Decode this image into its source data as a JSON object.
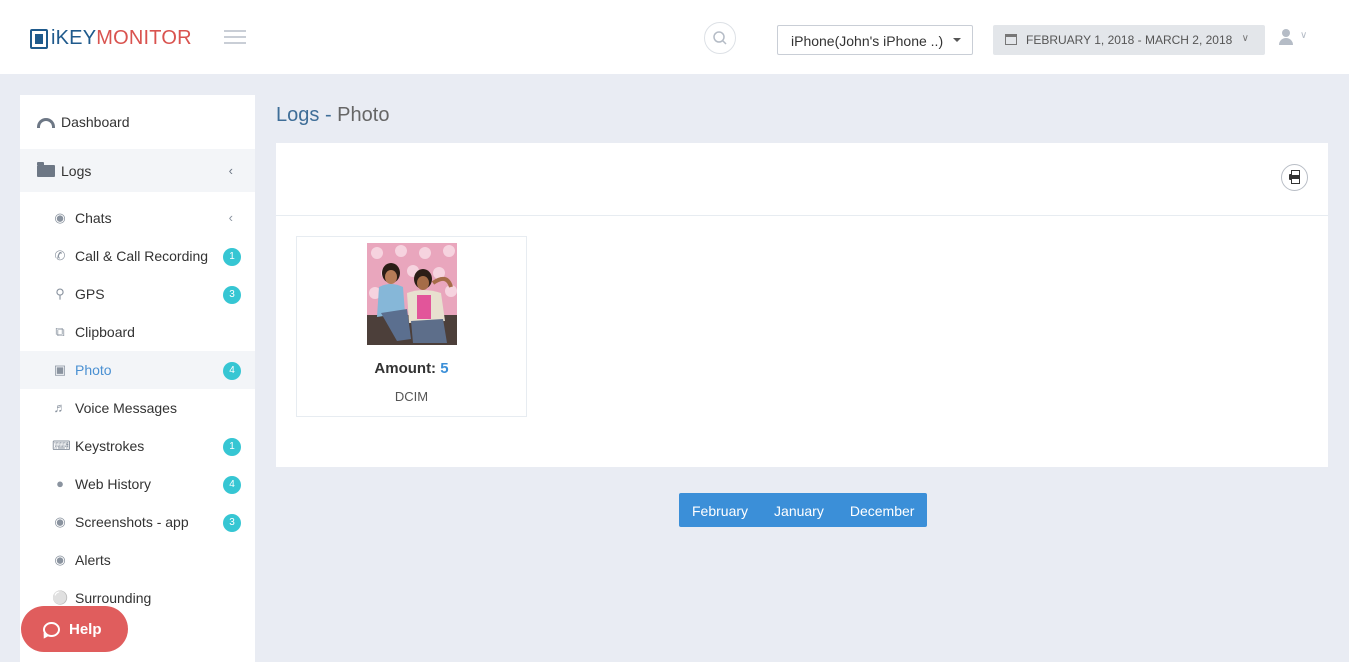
{
  "brand": {
    "logo_part1": "iKEY",
    "logo_part2": "MONITOR"
  },
  "header": {
    "device_selected": "iPhone(John's iPhone ..)",
    "date_range": "FEBRUARY 1, 2018 - MARCH 2, 2018"
  },
  "sidebar": {
    "dashboard_label": "Dashboard",
    "logs_label": "Logs",
    "items": [
      {
        "label": "Chats",
        "icon": "chat-icon",
        "badge": ""
      },
      {
        "label": "Call & Call Recording",
        "icon": "phone-icon",
        "badge": "1"
      },
      {
        "label": "GPS",
        "icon": "map-marker-icon",
        "badge": "3"
      },
      {
        "label": "Clipboard",
        "icon": "clipboard-icon",
        "badge": ""
      },
      {
        "label": "Photo",
        "icon": "image-icon",
        "badge": "4"
      },
      {
        "label": "Voice Messages",
        "icon": "volume-icon",
        "badge": ""
      },
      {
        "label": "Keystrokes",
        "icon": "keyboard-icon",
        "badge": "1"
      },
      {
        "label": "Web History",
        "icon": "globe-icon",
        "badge": "4"
      },
      {
        "label": "Screenshots - app",
        "icon": "camera-icon",
        "badge": "3"
      },
      {
        "label": "Alerts",
        "icon": "camera-alert-icon",
        "badge": ""
      },
      {
        "label": "Surrounding",
        "icon": "microphone-icon",
        "badge": ""
      }
    ]
  },
  "help": {
    "label": "Help"
  },
  "main": {
    "title_section": "Logs",
    "title_separator": "-",
    "title_page": "Photo",
    "album": {
      "amount_label": "Amount:",
      "amount_value": "5",
      "name": "DCIM"
    },
    "months": [
      "February",
      "January",
      "December"
    ]
  },
  "colors": {
    "accent": "#3b8fd8",
    "badge": "#36c6d3",
    "help": "#e05d5d",
    "logo_blue": "#1f5a8c",
    "logo_red": "#d9534f"
  }
}
